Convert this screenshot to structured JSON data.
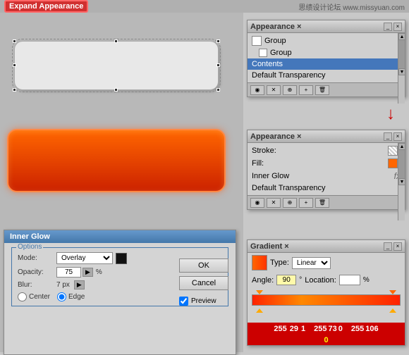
{
  "banner": {
    "expand_label": "Expand Appearance",
    "site_info": "思绩设计论坛 www.missyuan.com"
  },
  "appearance_panel_top": {
    "title": "Appearance",
    "rows": [
      {
        "label": "Group",
        "type": "header"
      },
      {
        "label": "Group",
        "type": "indent"
      },
      {
        "label": "Contents",
        "type": "selected"
      },
      {
        "label": "Default Transparency",
        "type": "normal"
      }
    ],
    "bottom_icons": [
      "circle-icon",
      "delete-icon",
      "link-icon",
      "new-icon",
      "trash-icon"
    ]
  },
  "appearance_panel_bottom": {
    "title": "Appearance",
    "rows": [
      {
        "label": "Stroke:",
        "type": "stroke"
      },
      {
        "label": "Fill:",
        "type": "fill"
      },
      {
        "label": "Inner Glow",
        "type": "effect"
      },
      {
        "label": "Default Transparency",
        "type": "normal"
      }
    ]
  },
  "inner_glow": {
    "title": "Inner Glow",
    "options_label": "Options",
    "mode_label": "Mode:",
    "mode_value": "Overlay",
    "opacity_label": "Opacity:",
    "opacity_value": "75",
    "opacity_unit": "%",
    "blur_label": "Blur:",
    "blur_value": "7 px",
    "center_label": "Center",
    "edge_label": "Edge",
    "ok_label": "OK",
    "cancel_label": "Cancel",
    "preview_label": "Preview"
  },
  "gradient_panel": {
    "title": "Gradient",
    "type_label": "Type:",
    "type_value": "Linear",
    "angle_label": "Angle:",
    "angle_value": "90",
    "location_label": "Location:",
    "location_value": "",
    "location_unit": "%",
    "values": [
      "255",
      "29",
      "1",
      "255",
      "73",
      "0",
      "255",
      "106"
    ],
    "zero": "0"
  }
}
